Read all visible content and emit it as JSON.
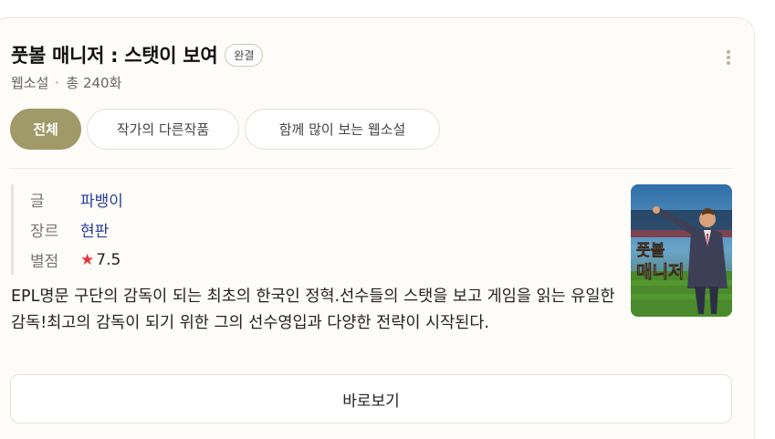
{
  "card": {
    "title": "풋볼 매니저 : 스탯이 보여",
    "badge": "완결",
    "meta": {
      "genre_type": "웹소설",
      "episodes": "총 240화"
    },
    "tabs": [
      {
        "label": "전체",
        "active": true
      },
      {
        "label": "작가의 다른작품",
        "active": false
      },
      {
        "label": "함께 많이 보는 웹소설",
        "active": false
      }
    ],
    "info": {
      "author_label": "글",
      "author": "파뱅이",
      "genre_label": "장르",
      "genre": "현판",
      "rating_label": "별점",
      "star": "★",
      "rating": "7.5"
    },
    "description": "EPL명문 구단의 감독이 되는 최초의 한국인 정혁.선수들의 스탯을 보고 게임을 읽는 유일한 감독!최고의 감독이 되기 위한 그의 선수영입과 다양한 전략이 시작된다.",
    "cover": {
      "title_line1": "풋볼",
      "title_line2": "매니저"
    },
    "view_button": "바로보기"
  },
  "colors": {
    "accent": "#a09a68",
    "link": "#2a3d96",
    "star": "#e8343f"
  },
  "icons": {
    "more": "more-vertical-icon",
    "star": "star-icon"
  }
}
